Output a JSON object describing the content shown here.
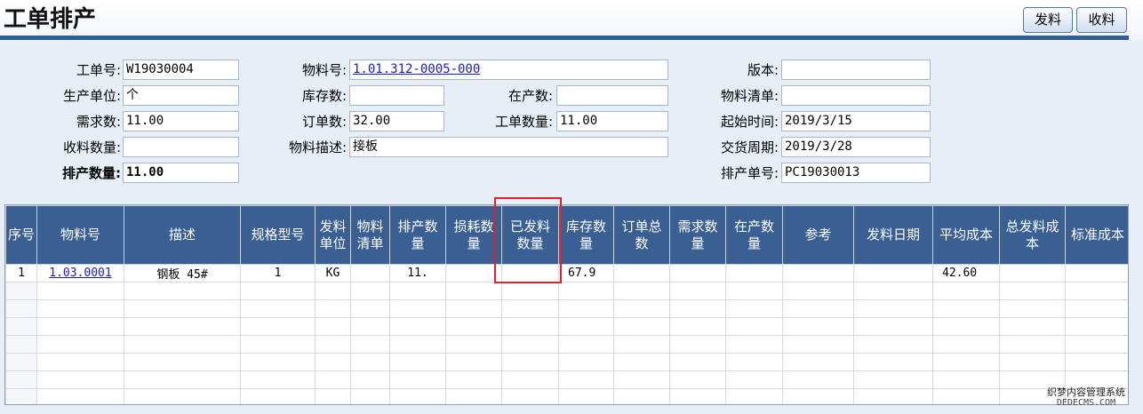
{
  "header": {
    "title": "工单排产",
    "issue_button": "发料",
    "receive_button": "收料"
  },
  "form": {
    "work_order_no": {
      "label": "工单号:",
      "value": "W19030004"
    },
    "production_unit": {
      "label": "生产单位:",
      "value": "个"
    },
    "demand_qty": {
      "label": "需求数:",
      "value": "11.00"
    },
    "received_qty": {
      "label": "收料数量:",
      "value": ""
    },
    "scheduled_qty": {
      "label": "排产数量:",
      "value": "11.00"
    },
    "material_no": {
      "label": "物料号:",
      "value": "1.01.312-0005-000"
    },
    "stock_qty": {
      "label": "库存数:",
      "value": ""
    },
    "in_production_qty": {
      "label": "在产数:",
      "value": ""
    },
    "order_qty": {
      "label": "订单数:",
      "value": "32.00"
    },
    "work_order_qty": {
      "label": "工单数量:",
      "value": "11.00"
    },
    "material_desc": {
      "label": "物料描述:",
      "value": "接板"
    },
    "version": {
      "label": "版本:",
      "value": ""
    },
    "bom": {
      "label": "物料清单:",
      "value": ""
    },
    "start_time": {
      "label": "起始时间:",
      "value": "2019/3/15"
    },
    "delivery_period": {
      "label": "交货周期:",
      "value": "2019/3/28"
    },
    "schedule_no": {
      "label": "排产单号:",
      "value": "PC19030013"
    }
  },
  "grid": {
    "columns": [
      "序号",
      "物料号",
      "描述",
      "规格型号",
      "发料单位",
      "物料清单",
      "排产数量",
      "损耗数量",
      "已发料数量",
      "库存数量",
      "订单总数",
      "需求数量",
      "在产数量",
      "参考",
      "发料日期",
      "平均成本",
      "总发料成本",
      "标准成本"
    ],
    "rows": [
      [
        "1",
        "1.03.0001",
        "钢板 45#",
        "1",
        "KG",
        "",
        "11.",
        "",
        "",
        "67.9",
        "",
        "",
        "",
        "",
        "",
        "42.60",
        "",
        ""
      ]
    ]
  },
  "watermark": {
    "line1": "织梦内容管理系统",
    "line2": "DEDECMS.COM"
  },
  "colors": {
    "header_bar": "#2f5d95",
    "grid_header": "#3a5f93",
    "highlight": "#e0202a",
    "link": "#1a1acc"
  }
}
